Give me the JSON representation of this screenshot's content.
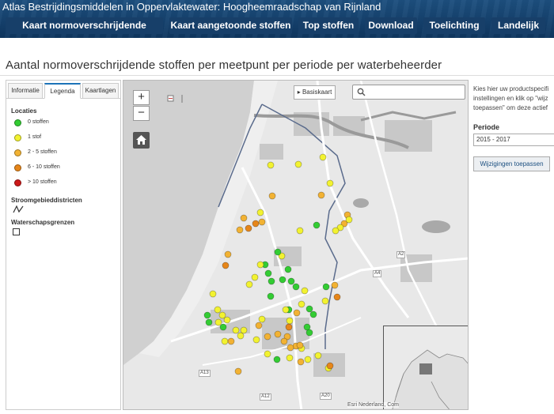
{
  "site": {
    "title": "Atlas Bestrijdingsmiddelen in Oppervlaktewater: Hoogheemraadschap van Rijnland"
  },
  "nav": [
    {
      "label": "Kaart normoverschrijdende stoffen"
    },
    {
      "label": "Kaart aangetoonde stoffen"
    },
    {
      "label": "Top stoffen"
    },
    {
      "label": "Download"
    },
    {
      "label": "Toelichting"
    },
    {
      "label": "Landelijk"
    }
  ],
  "page": {
    "title": "Aantal normoverschrijdende stoffen per meetpunt per periode per waterbeheerder"
  },
  "tabs": [
    {
      "label": "Informatie"
    },
    {
      "label": "Legenda"
    },
    {
      "label": "Kaartlagen"
    }
  ],
  "legend": {
    "locaties_heading": "Locaties",
    "items": [
      {
        "label": "0 stoffen",
        "color": "#33cc33"
      },
      {
        "label": "1 stof",
        "color": "#f2f230"
      },
      {
        "label": "2 - 5 stoffen",
        "color": "#f2b233"
      },
      {
        "label": "6 - 10 stoffen",
        "color": "#e6861a"
      },
      {
        "label": "> 10 stoffen",
        "color": "#cc1a1a"
      }
    ],
    "stroomgebied_heading": "Stroomgebieddistricten",
    "waterschap_heading": "Waterschapsgrenzen"
  },
  "map": {
    "zoom_in": "+",
    "zoom_out": "−",
    "basemap_label": "Basiskaart",
    "search_placeholder": "",
    "attribution": "Esri Nederland, Com",
    "road_labels": [
      "A2",
      "A12",
      "A13",
      "A20",
      "A4"
    ]
  },
  "side": {
    "info_lines": [
      "Kies hier uw productspecifi",
      "instellingen en klik op \"wijz",
      "toepassen\" om deze actief"
    ],
    "period_label": "Periode",
    "period_value": "2015 - 2017",
    "apply_label": "Wijzigingen toepassen"
  }
}
